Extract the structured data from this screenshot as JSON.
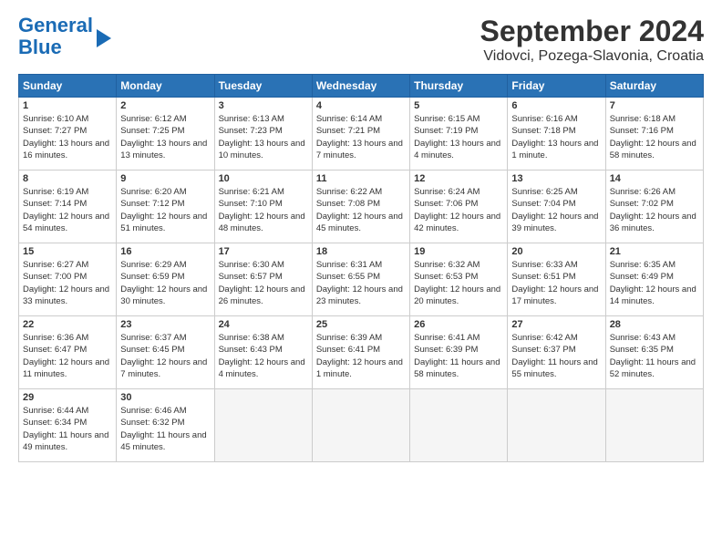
{
  "header": {
    "logo_line1": "General",
    "logo_line2": "Blue",
    "title": "September 2024",
    "subtitle": "Vidovci, Pozega-Slavonia, Croatia"
  },
  "calendar": {
    "headers": [
      "Sunday",
      "Monday",
      "Tuesday",
      "Wednesday",
      "Thursday",
      "Friday",
      "Saturday"
    ],
    "weeks": [
      [
        {
          "day": "1",
          "sunrise": "6:10 AM",
          "sunset": "7:27 PM",
          "daylight": "13 hours and 16 minutes."
        },
        {
          "day": "2",
          "sunrise": "6:12 AM",
          "sunset": "7:25 PM",
          "daylight": "13 hours and 13 minutes."
        },
        {
          "day": "3",
          "sunrise": "6:13 AM",
          "sunset": "7:23 PM",
          "daylight": "13 hours and 10 minutes."
        },
        {
          "day": "4",
          "sunrise": "6:14 AM",
          "sunset": "7:21 PM",
          "daylight": "13 hours and 7 minutes."
        },
        {
          "day": "5",
          "sunrise": "6:15 AM",
          "sunset": "7:19 PM",
          "daylight": "13 hours and 4 minutes."
        },
        {
          "day": "6",
          "sunrise": "6:16 AM",
          "sunset": "7:18 PM",
          "daylight": "13 hours and 1 minute."
        },
        {
          "day": "7",
          "sunrise": "6:18 AM",
          "sunset": "7:16 PM",
          "daylight": "12 hours and 58 minutes."
        }
      ],
      [
        {
          "day": "8",
          "sunrise": "6:19 AM",
          "sunset": "7:14 PM",
          "daylight": "12 hours and 54 minutes."
        },
        {
          "day": "9",
          "sunrise": "6:20 AM",
          "sunset": "7:12 PM",
          "daylight": "12 hours and 51 minutes."
        },
        {
          "day": "10",
          "sunrise": "6:21 AM",
          "sunset": "7:10 PM",
          "daylight": "12 hours and 48 minutes."
        },
        {
          "day": "11",
          "sunrise": "6:22 AM",
          "sunset": "7:08 PM",
          "daylight": "12 hours and 45 minutes."
        },
        {
          "day": "12",
          "sunrise": "6:24 AM",
          "sunset": "7:06 PM",
          "daylight": "12 hours and 42 minutes."
        },
        {
          "day": "13",
          "sunrise": "6:25 AM",
          "sunset": "7:04 PM",
          "daylight": "12 hours and 39 minutes."
        },
        {
          "day": "14",
          "sunrise": "6:26 AM",
          "sunset": "7:02 PM",
          "daylight": "12 hours and 36 minutes."
        }
      ],
      [
        {
          "day": "15",
          "sunrise": "6:27 AM",
          "sunset": "7:00 PM",
          "daylight": "12 hours and 33 minutes."
        },
        {
          "day": "16",
          "sunrise": "6:29 AM",
          "sunset": "6:59 PM",
          "daylight": "12 hours and 30 minutes."
        },
        {
          "day": "17",
          "sunrise": "6:30 AM",
          "sunset": "6:57 PM",
          "daylight": "12 hours and 26 minutes."
        },
        {
          "day": "18",
          "sunrise": "6:31 AM",
          "sunset": "6:55 PM",
          "daylight": "12 hours and 23 minutes."
        },
        {
          "day": "19",
          "sunrise": "6:32 AM",
          "sunset": "6:53 PM",
          "daylight": "12 hours and 20 minutes."
        },
        {
          "day": "20",
          "sunrise": "6:33 AM",
          "sunset": "6:51 PM",
          "daylight": "12 hours and 17 minutes."
        },
        {
          "day": "21",
          "sunrise": "6:35 AM",
          "sunset": "6:49 PM",
          "daylight": "12 hours and 14 minutes."
        }
      ],
      [
        {
          "day": "22",
          "sunrise": "6:36 AM",
          "sunset": "6:47 PM",
          "daylight": "12 hours and 11 minutes."
        },
        {
          "day": "23",
          "sunrise": "6:37 AM",
          "sunset": "6:45 PM",
          "daylight": "12 hours and 7 minutes."
        },
        {
          "day": "24",
          "sunrise": "6:38 AM",
          "sunset": "6:43 PM",
          "daylight": "12 hours and 4 minutes."
        },
        {
          "day": "25",
          "sunrise": "6:39 AM",
          "sunset": "6:41 PM",
          "daylight": "12 hours and 1 minute."
        },
        {
          "day": "26",
          "sunrise": "6:41 AM",
          "sunset": "6:39 PM",
          "daylight": "11 hours and 58 minutes."
        },
        {
          "day": "27",
          "sunrise": "6:42 AM",
          "sunset": "6:37 PM",
          "daylight": "11 hours and 55 minutes."
        },
        {
          "day": "28",
          "sunrise": "6:43 AM",
          "sunset": "6:35 PM",
          "daylight": "11 hours and 52 minutes."
        }
      ],
      [
        {
          "day": "29",
          "sunrise": "6:44 AM",
          "sunset": "6:34 PM",
          "daylight": "11 hours and 49 minutes."
        },
        {
          "day": "30",
          "sunrise": "6:46 AM",
          "sunset": "6:32 PM",
          "daylight": "11 hours and 45 minutes."
        },
        null,
        null,
        null,
        null,
        null
      ]
    ]
  }
}
